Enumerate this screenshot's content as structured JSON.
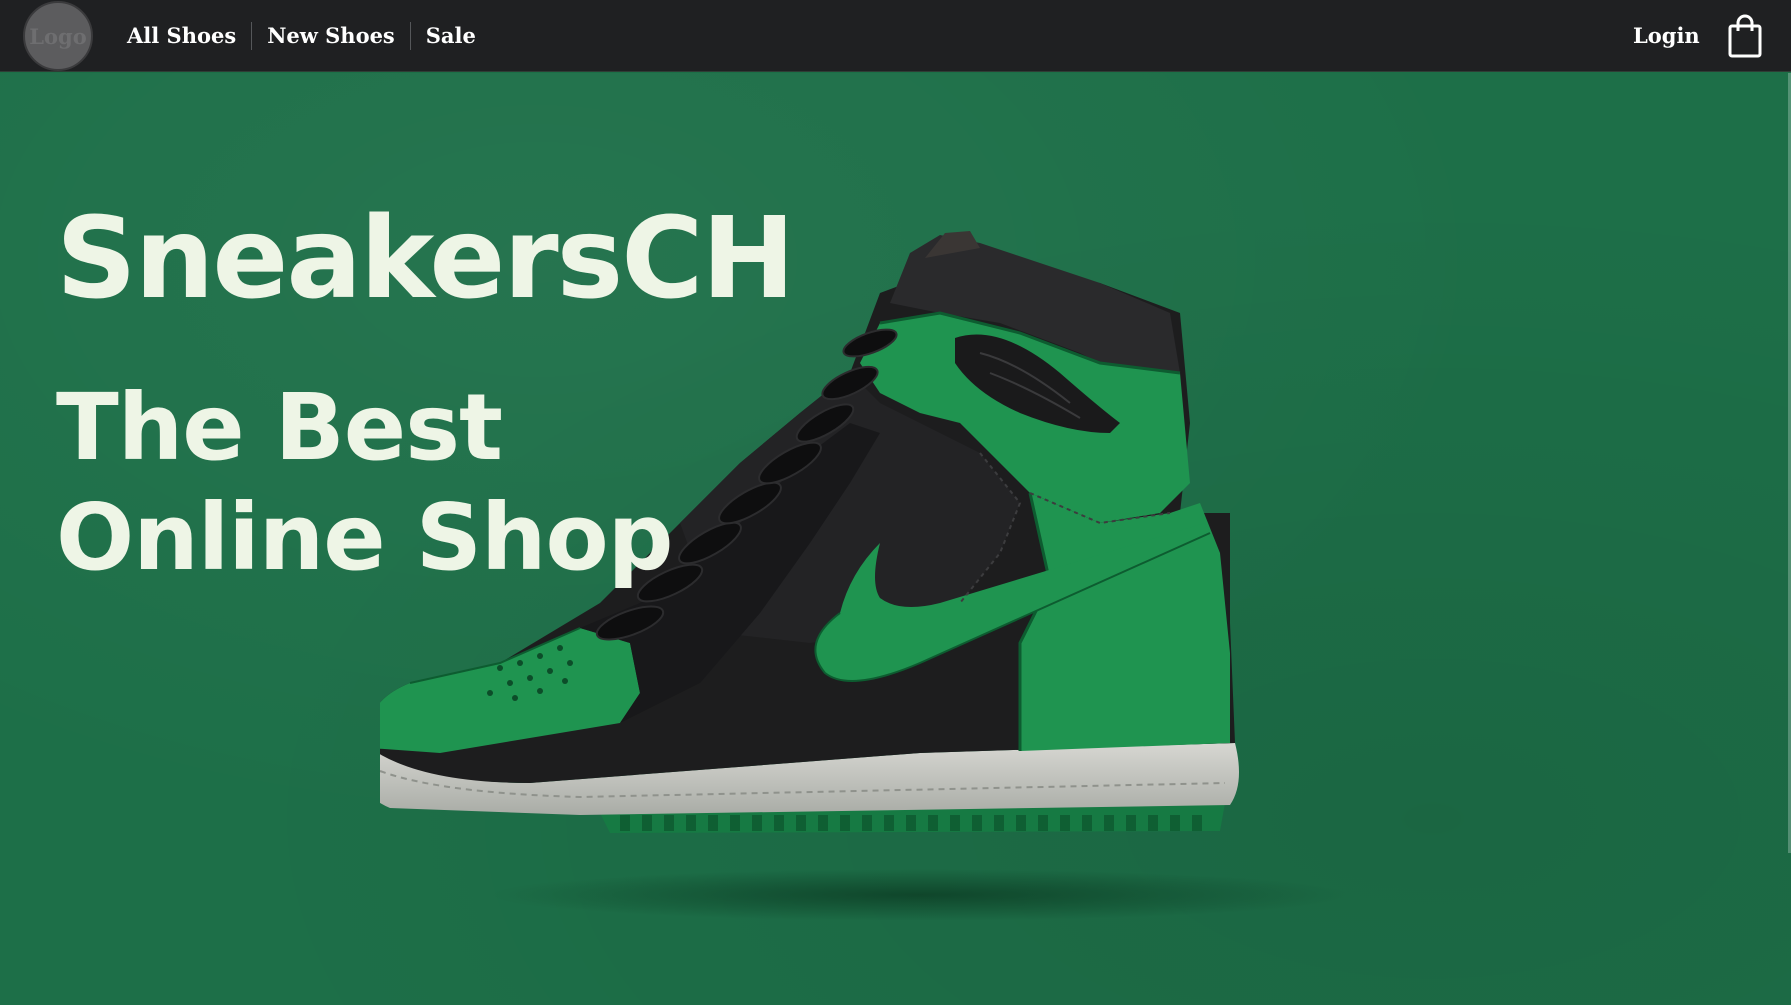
{
  "nav": {
    "logo_text": "Logo",
    "links": [
      "All Shoes",
      "New Shoes",
      "Sale"
    ],
    "login": "Login",
    "cart_icon": "shopping-bag-icon"
  },
  "hero": {
    "title": "SneakersCH",
    "tagline_line1": "The Best",
    "tagline_line2": "Online Shop",
    "image": "green-black-high-top-sneaker",
    "background_color": "#1d6f48"
  },
  "colors": {
    "navbar": "#1f2022",
    "hero_text": "#eef5e6",
    "accent_green": "#1e9a52"
  }
}
